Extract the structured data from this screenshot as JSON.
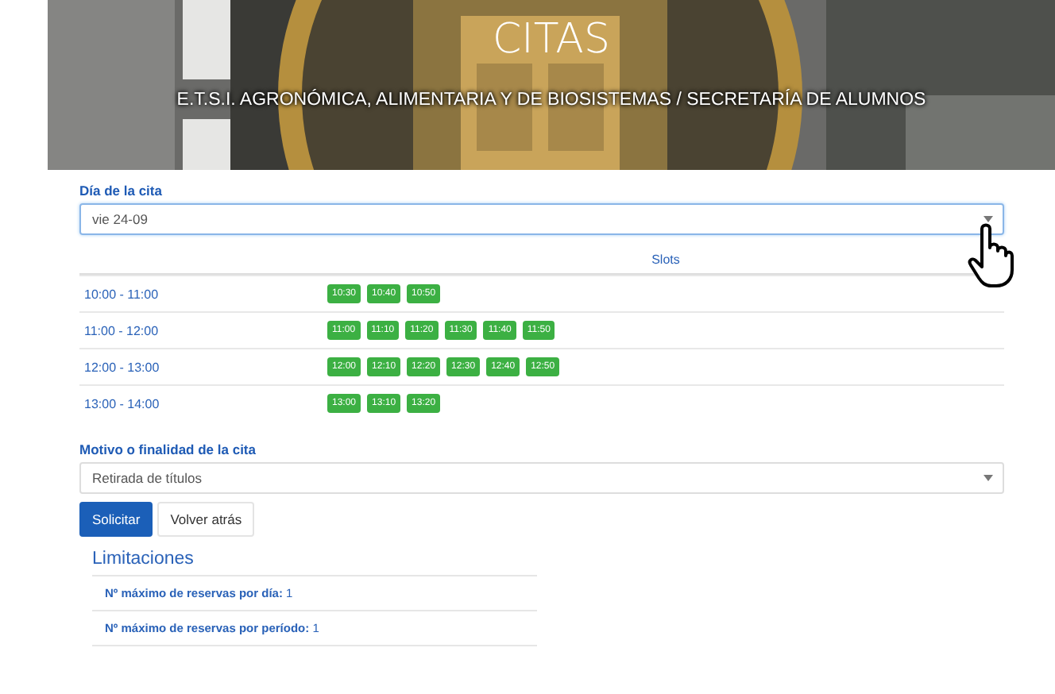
{
  "header": {
    "title": "CITAS",
    "breadcrumb": "E.T.S.I. AGRONÓMICA, ALIMENTARIA Y DE BIOSISTEMAS / SECRETARÍA DE ALUMNOS"
  },
  "day_field": {
    "label": "Día de la cita",
    "value": "vie 24-09",
    "focused": true
  },
  "slots_table": {
    "columns": [
      "Slots"
    ],
    "rows": [
      {
        "period": "10:00 - 11:00",
        "slots": [
          "10:30",
          "10:40",
          "10:50"
        ]
      },
      {
        "period": "11:00 - 12:00",
        "slots": [
          "11:00",
          "11:10",
          "11:20",
          "11:30",
          "11:40",
          "11:50"
        ]
      },
      {
        "period": "12:00 - 13:00",
        "slots": [
          "12:00",
          "12:10",
          "12:20",
          "12:30",
          "12:40",
          "12:50"
        ]
      },
      {
        "period": "13:00 - 14:00",
        "slots": [
          "13:00",
          "13:10",
          "13:20"
        ]
      }
    ]
  },
  "reason_field": {
    "label": "Motivo o finalidad de la cita",
    "value": "Retirada de títulos",
    "focused": false
  },
  "buttons": [
    {
      "label": "Solicitar",
      "kind": "primary"
    },
    {
      "label": "Volver atrás",
      "kind": "secondary"
    }
  ],
  "limits": {
    "title": "Limitaciones",
    "items": [
      "**Nº máximo de reservas por día:** 1",
      "**Nº máximo de reservas por período:** 1"
    ]
  }
}
